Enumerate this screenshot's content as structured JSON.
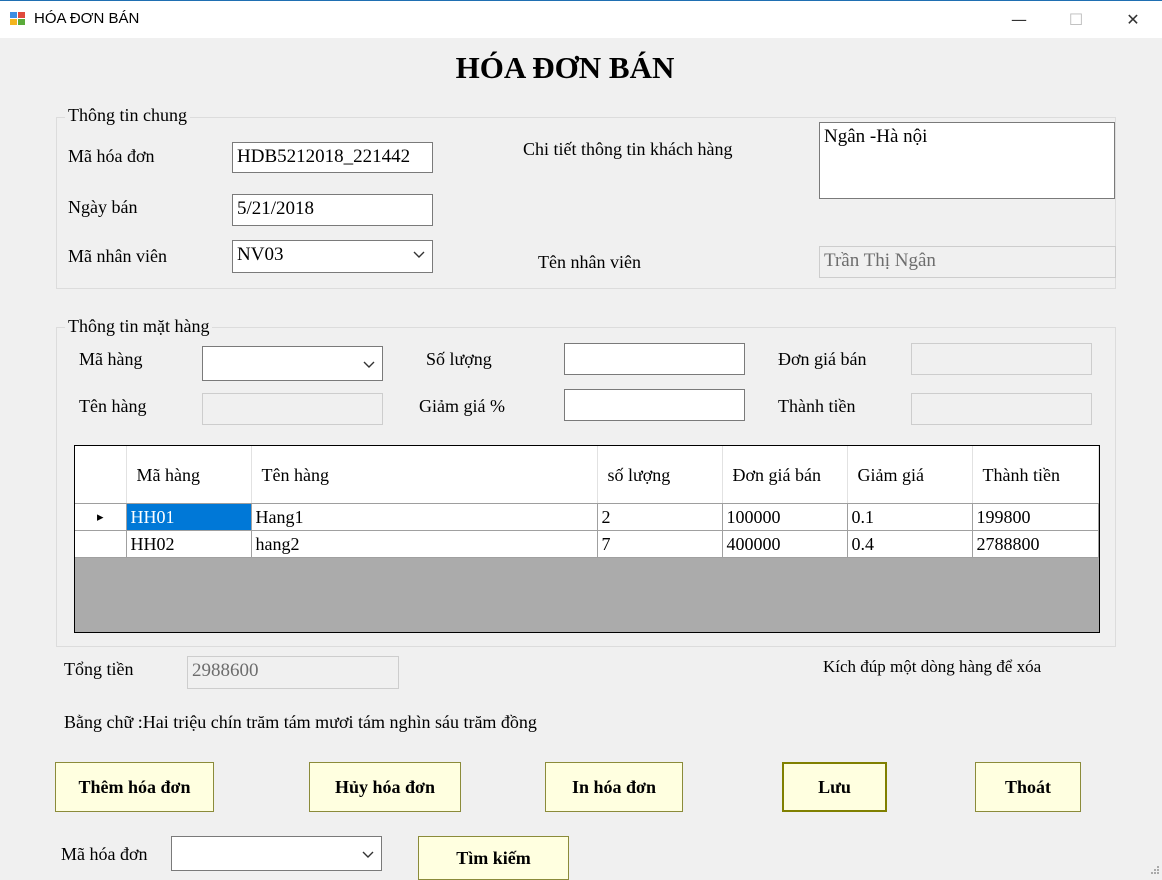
{
  "window": {
    "title": "HÓA ĐƠN BÁN",
    "minimize": "—",
    "maximize": "☐",
    "close": "✕"
  },
  "form_title": "HÓA ĐƠN BÁN",
  "general": {
    "legend": "Thông tin chung",
    "invoice_id_label": "Mã hóa đơn",
    "invoice_id_value": "HDB5212018_221442",
    "sale_date_label": "Ngày bán",
    "sale_date_value": "5/21/2018",
    "employee_id_label": "Mã nhân viên",
    "employee_id_value": "NV03",
    "customer_detail_label": "Chi tiết thông tin khách hàng",
    "customer_detail_value": "Ngân -Hà nội",
    "employee_name_label": "Tên nhân viên",
    "employee_name_value": "Trần Thị Ngân"
  },
  "items": {
    "legend": "Thông tin mặt hàng",
    "item_code_label": "Mã hàng",
    "item_code_value": "",
    "quantity_label": "Số lượng",
    "quantity_value": "",
    "unit_price_label": "Đơn giá bán",
    "unit_price_value": "",
    "item_name_label": "Tên hàng",
    "item_name_value": "",
    "discount_label": "Giảm giá %",
    "discount_value": "",
    "amount_label": "Thành tiền",
    "amount_value": ""
  },
  "grid": {
    "columns": [
      "Mã hàng",
      "Tên hàng",
      "số lượng",
      "Đơn giá bán",
      "Giảm giá",
      "Thành tiền"
    ],
    "rows": [
      [
        "HH01",
        "Hang1",
        "2",
        "100000",
        "0.1",
        "199800"
      ],
      [
        "HH02",
        "hang2",
        "7",
        "400000",
        "0.4",
        "2788800"
      ]
    ],
    "current_row_marker": "▸"
  },
  "total_label": "Tổng tiền",
  "total_value": "2988600",
  "delete_hint": "Kích đúp một dòng hàng để xóa",
  "in_words": "Bằng chữ  :Hai triệu chín trăm tám mươi tám nghìn sáu trăm đồng",
  "buttons": {
    "add": "Thêm hóa đơn",
    "cancel": "Hủy hóa đơn",
    "print": "In hóa đơn",
    "save": "Lưu",
    "exit": "Thoát",
    "search": "Tìm kiếm"
  },
  "search": {
    "invoice_label": "Mã hóa đơn",
    "invoice_value": ""
  }
}
